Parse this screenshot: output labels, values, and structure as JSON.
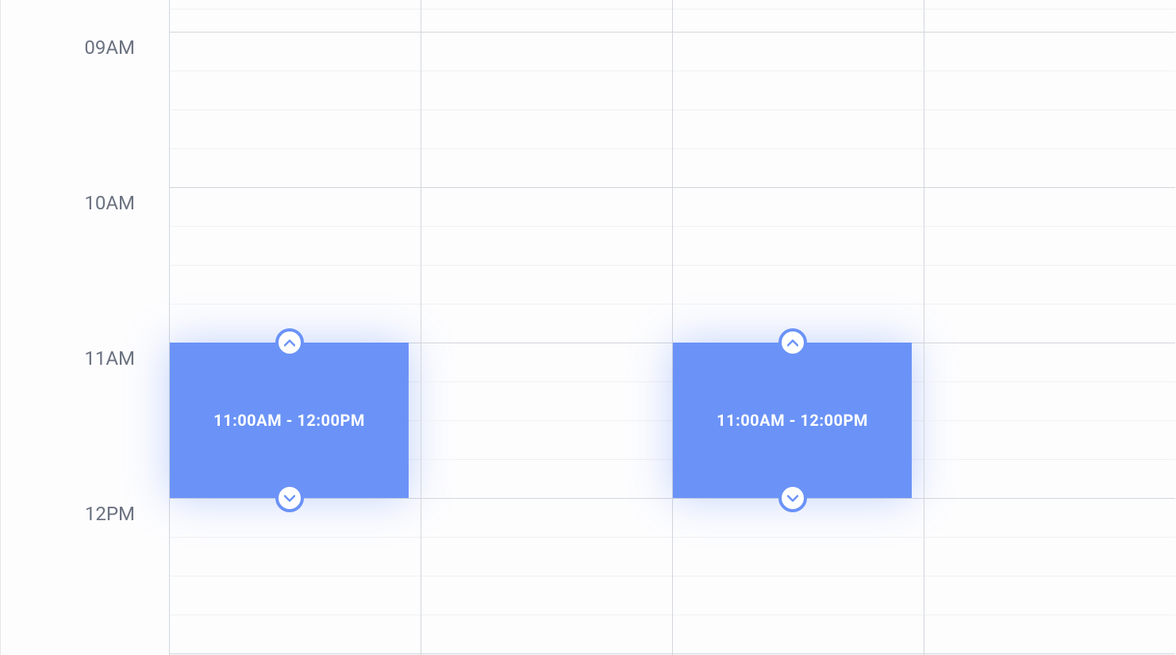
{
  "timeLabels": {
    "t0": "09AM",
    "t1": "10AM",
    "t2": "11AM",
    "t3": "12PM"
  },
  "events": {
    "event1": {
      "label": "11:00AM - 12:00PM"
    },
    "event2": {
      "label": "11:00AM - 12:00PM"
    }
  },
  "layout": {
    "hourHeight": 196,
    "startOffset": -136
  }
}
